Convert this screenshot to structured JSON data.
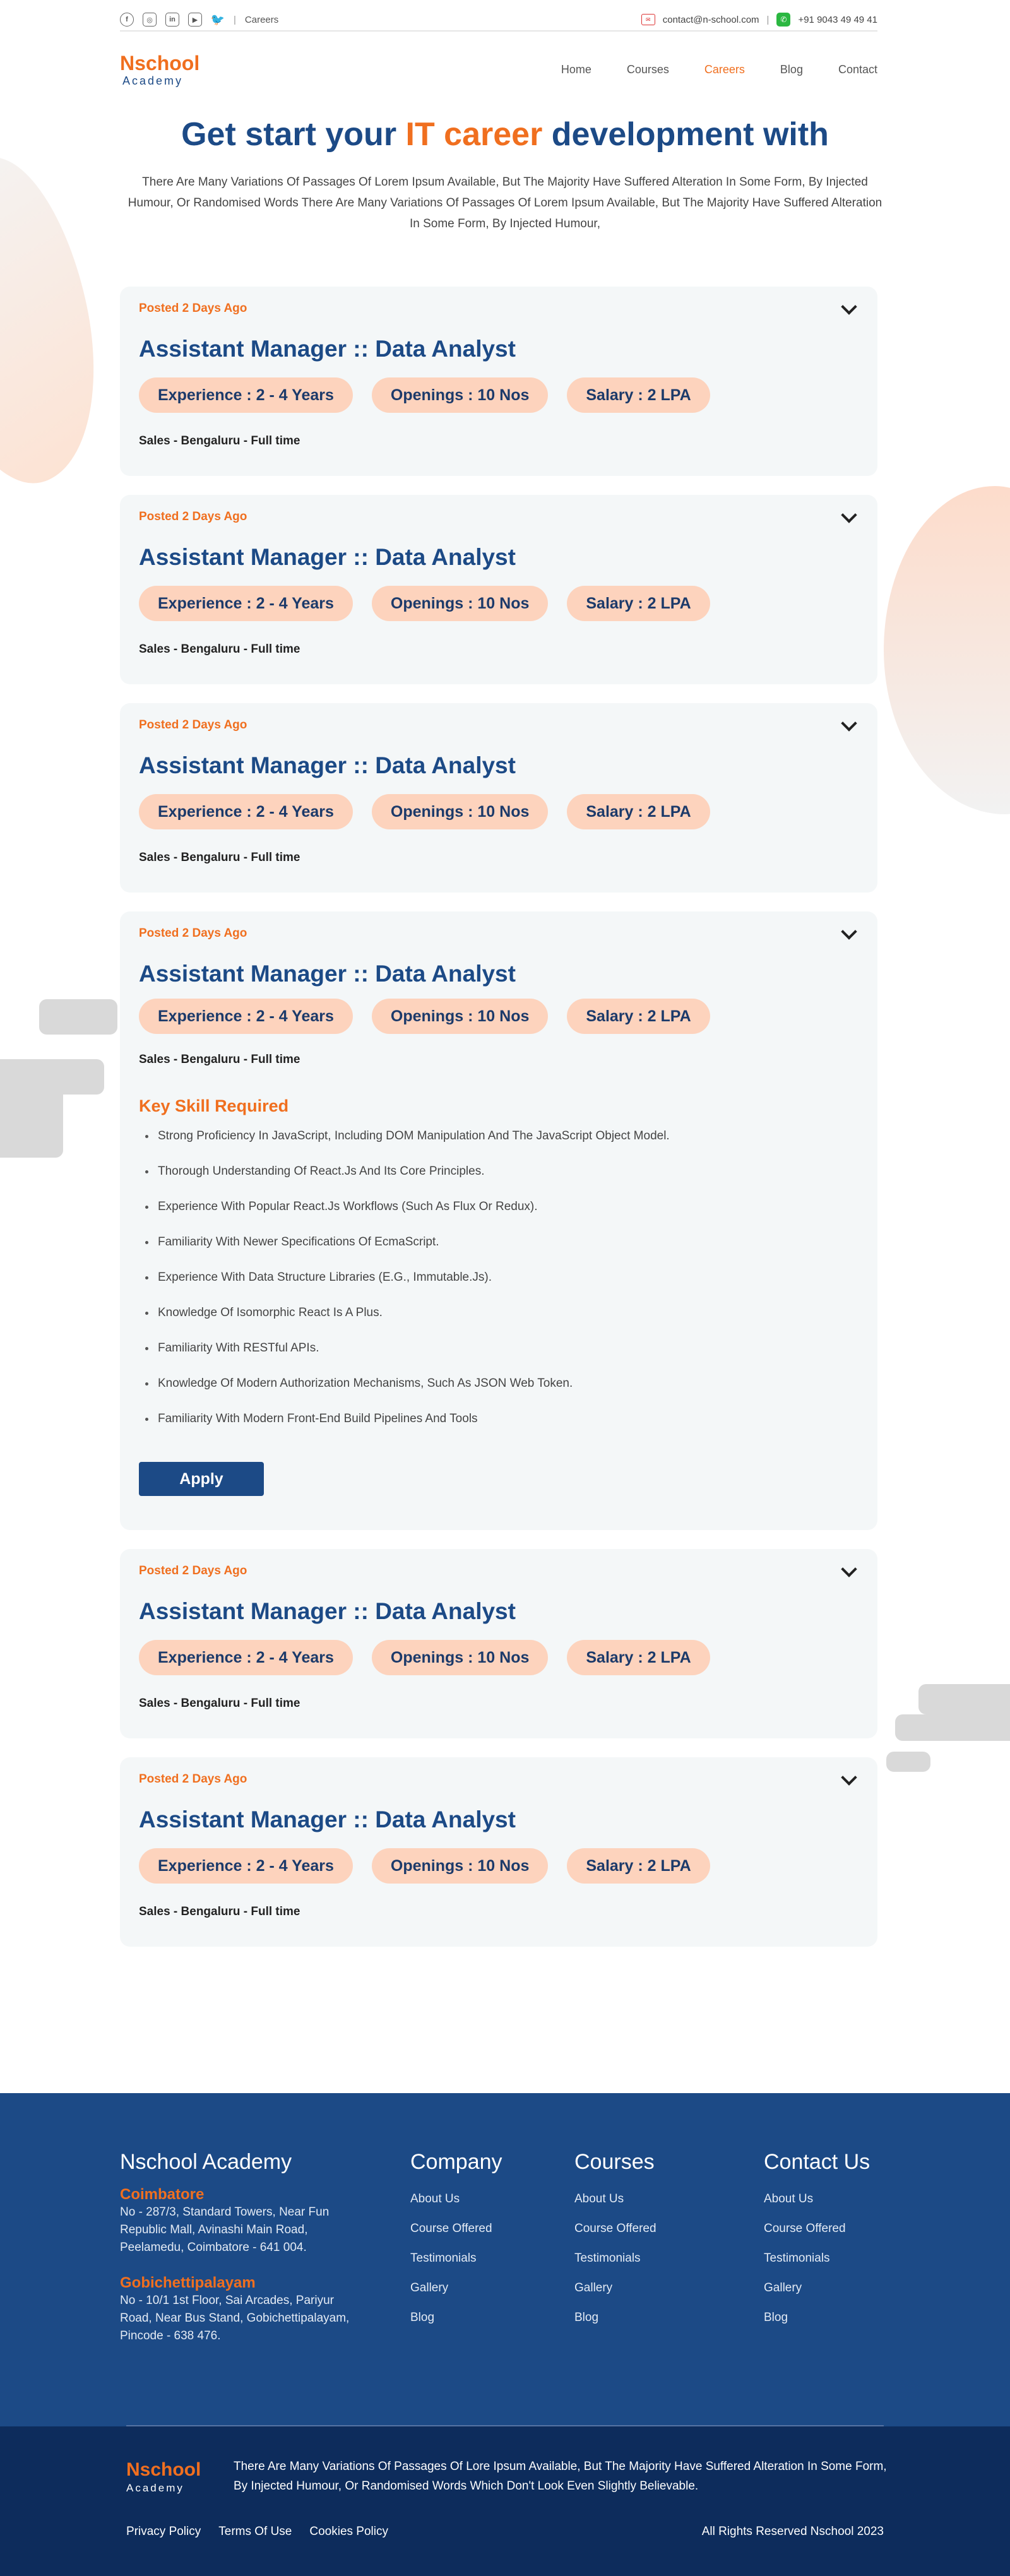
{
  "topbar": {
    "social_icons": [
      "facebook-icon",
      "instagram-icon",
      "linkedin-icon",
      "youtube-icon",
      "twitter-icon"
    ],
    "breadcrumb": "Careers",
    "email": "contact@n-school.com",
    "phone": "+91 9043 49 49 41"
  },
  "header": {
    "logo_main": "Nschool",
    "logo_sub": "Academy",
    "nav": [
      "Home",
      "Courses",
      "Careers",
      "Blog",
      "Contact"
    ],
    "active_nav": "Careers"
  },
  "hero": {
    "title_part1": "Get start your ",
    "title_accent": "IT career",
    "title_part2": " development with",
    "text": "There Are Many Variations Of Passages Of Lorem Ipsum Available, But The Majority Have Suffered Alteration In Some Form, By Injected Humour, Or Randomised Words There Are Many Variations Of Passages Of Lorem Ipsum Available, But The Majority Have Suffered Alteration In Some Form, By Injected Humour,"
  },
  "jobs": [
    {
      "posted": "Posted 2 Days Ago",
      "title": "Assistant Manager :: Data Analyst",
      "experience": "Experience : 2 - 4 Years",
      "openings": "Openings : 10 Nos",
      "salary": "Salary : 2 LPA",
      "location": "Sales - Bengaluru - Full time"
    },
    {
      "posted": "Posted 2 Days Ago",
      "title": "Assistant Manager :: Data Analyst",
      "experience": "Experience : 2 - 4 Years",
      "openings": "Openings : 10 Nos",
      "salary": "Salary : 2 LPA",
      "location": "Sales - Bengaluru - Full time"
    },
    {
      "posted": "Posted 2 Days Ago",
      "title": "Assistant Manager :: Data Analyst",
      "experience": "Experience : 2 - 4 Years",
      "openings": "Openings : 10 Nos",
      "salary": "Salary : 2 LPA",
      "location": "Sales - Bengaluru - Full time"
    },
    {
      "posted": "Posted 2 Days Ago",
      "title": "Assistant Manager :: Data Analyst",
      "experience": "Experience : 2 - 4 Years",
      "openings": "Openings : 10 Nos",
      "salary": "Salary : 2 LPA",
      "location": "Sales - Bengaluru - Full time"
    },
    {
      "posted": "Posted 2 Days Ago",
      "title": "Assistant Manager :: Data Analyst",
      "experience": "Experience : 2 - 4 Years",
      "openings": "Openings : 10 Nos",
      "salary": "Salary : 2 LPA",
      "location": "Sales - Bengaluru - Full time"
    },
    {
      "posted": "Posted 2 Days Ago",
      "title": "Assistant Manager :: Data Analyst",
      "experience": "Experience : 2 - 4 Years",
      "openings": "Openings : 10 Nos",
      "salary": "Salary : 2 LPA",
      "location": "Sales - Bengaluru - Full time"
    }
  ],
  "expanded": {
    "skills_title": "Key Skill Required",
    "skills": [
      "Strong Proficiency In JavaScript, Including DOM Manipulation And The JavaScript Object Model.",
      "Thorough Understanding Of React.Js And Its Core Principles.",
      "Experience With Popular React.Js Workflows (Such As Flux Or Redux).",
      "Familiarity With Newer Specifications Of EcmaScript.",
      "Experience With Data Structure Libraries (E.G., Immutable.Js).",
      "Knowledge Of Isomorphic React Is A Plus.",
      "Familiarity With RESTful APIs.",
      "Knowledge Of Modern Authorization Mechanisms, Such As JSON Web Token.",
      "Familiarity With Modern Front-End Build Pipelines And Tools"
    ],
    "apply_label": "Apply"
  },
  "footer": {
    "academy_title": "Nschool Academy",
    "city1": "Coimbatore",
    "addr1": "No - 287/3, Standard Towers, Near Fun Republic Mall, Avinashi Main Road, Peelamedu, Coimbatore - 641 004.",
    "city2": "Gobichettipalayam",
    "addr2": "No - 10/1 1st Floor, Sai Arcades, Pariyur Road, Near Bus Stand, Gobichettipalayam, Pincode - 638 476.",
    "company_title": "Company",
    "company_links": [
      "About Us",
      "Course Offered",
      "Testimonials",
      "Gallery",
      "Blog"
    ],
    "courses_title": "Courses",
    "courses_links": [
      "About Us",
      "Course Offered",
      "Testimonials",
      "Gallery",
      "Blog"
    ],
    "contact_title": "Contact Us",
    "contact_links": [
      "About Us",
      "Course Offered",
      "Testimonials",
      "Gallery"
    ],
    "contact_last": "Blog",
    "logo_main": "Nschool",
    "logo_sub": "Academy",
    "description": "There Are Many Variations Of Passages Of Lore Ipsum Available, But The Majority Have Suffered Alteration In Some Form, By Injected Humour, Or Randomised Words Which Don't Look Even Slightly Believable.",
    "bottom_links": [
      "Privacy Policy",
      "Terms Of Use",
      "Cookies Policy"
    ],
    "copyright": "All Rights Reserved Nschool 2023"
  },
  "colors": {
    "brand_orange": "#f06f1f",
    "brand_blue": "#1c4a86",
    "footer_dark": "#0d2c5c",
    "pill_bg": "#fdd3bd"
  }
}
